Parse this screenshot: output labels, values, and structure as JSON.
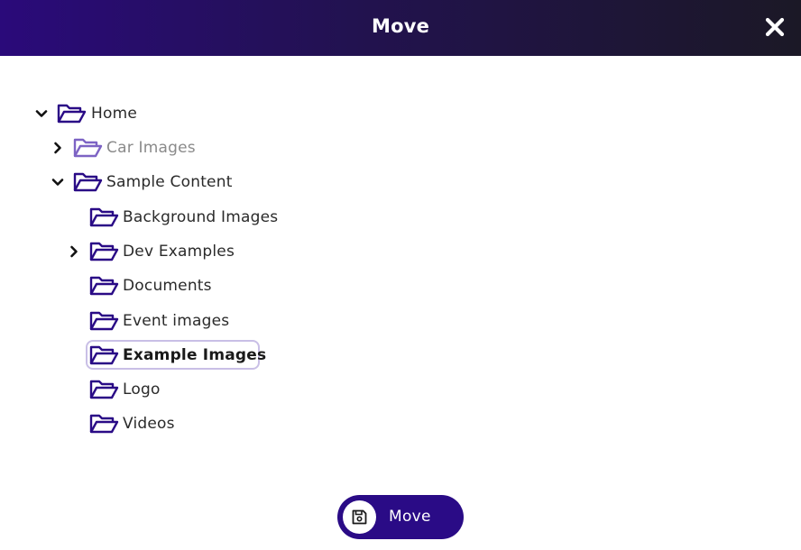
{
  "dialog": {
    "title": "Move",
    "close_icon": "close-icon"
  },
  "tree": {
    "items": [
      {
        "label": "Home",
        "expanded": true,
        "has_children": true,
        "muted": false,
        "selected": false
      },
      {
        "label": "Car Images",
        "expanded": false,
        "has_children": true,
        "muted": true,
        "selected": false
      },
      {
        "label": "Sample Content",
        "expanded": true,
        "has_children": true,
        "muted": false,
        "selected": false
      },
      {
        "label": "Background Images",
        "expanded": false,
        "has_children": false,
        "muted": false,
        "selected": false
      },
      {
        "label": "Dev Examples",
        "expanded": false,
        "has_children": true,
        "muted": false,
        "selected": false
      },
      {
        "label": "Documents",
        "expanded": false,
        "has_children": false,
        "muted": false,
        "selected": false
      },
      {
        "label": "Event images",
        "expanded": false,
        "has_children": false,
        "muted": false,
        "selected": false
      },
      {
        "label": "Example Images",
        "expanded": false,
        "has_children": false,
        "muted": false,
        "selected": true
      },
      {
        "label": "Logo",
        "expanded": false,
        "has_children": false,
        "muted": false,
        "selected": false
      },
      {
        "label": "Videos",
        "expanded": false,
        "has_children": false,
        "muted": false,
        "selected": false
      }
    ]
  },
  "footer": {
    "move_label": "Move",
    "move_icon": "save-icon"
  },
  "colors": {
    "accent": "#2a0b86",
    "folder": "#2a0b86",
    "folder_muted": "#7d63c4",
    "selection_border": "#c9bfe6"
  }
}
